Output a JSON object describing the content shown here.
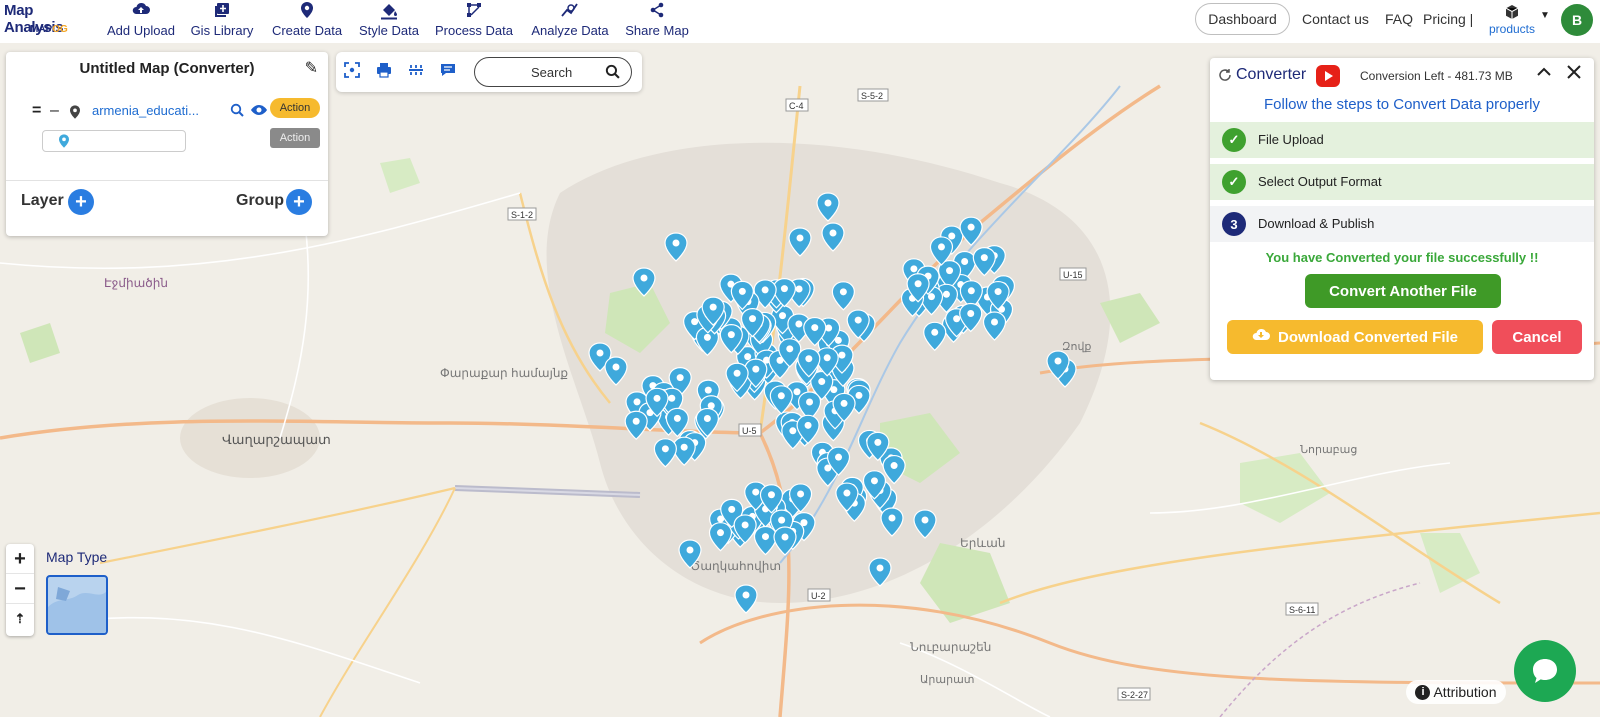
{
  "brand": {
    "title": "Map Analysis",
    "sub_prefix": "MAP",
    "sub_suffix": "OG"
  },
  "nav": [
    {
      "label": "Add Upload",
      "icon": "cloud-upload-icon"
    },
    {
      "label": "Gis Library",
      "icon": "library-icon"
    },
    {
      "label": "Create Data",
      "icon": "map-marker-icon"
    },
    {
      "label": "Style Data",
      "icon": "paint-bucket-icon"
    },
    {
      "label": "Process Data",
      "icon": "process-icon"
    },
    {
      "label": "Analyze Data",
      "icon": "analyze-icon"
    },
    {
      "label": "Share Map",
      "icon": "share-icon"
    }
  ],
  "header_right": {
    "dashboard": "Dashboard",
    "contact": "Contact us",
    "faq": "FAQ",
    "pricing": "Pricing |",
    "products": "products",
    "avatar_letter": "B"
  },
  "layer_panel": {
    "title": "Untitled Map (Converter)",
    "layer_name": "armenia_educati...",
    "action_label": "Action",
    "action_label_2": "Action",
    "layer_label": "Layer",
    "group_label": "Group"
  },
  "toolbar": {
    "search_placeholder": "Search"
  },
  "converter": {
    "title": "Converter",
    "conversion_left": "Conversion Left - 481.73 MB",
    "subtitle": "Follow the steps to Convert Data properly",
    "steps": [
      {
        "label": "File Upload",
        "status": "done"
      },
      {
        "label": "Select Output Format",
        "status": "done"
      },
      {
        "number": "3",
        "label": "Download & Publish",
        "status": "current"
      }
    ],
    "success_message": "You have Converted your file successfully !!",
    "convert_another": "Convert Another File",
    "download": "Download Converted File",
    "cancel": "Cancel"
  },
  "map": {
    "map_type_label": "Map Type",
    "attribution": "Attribution",
    "place_labels": [
      "Վաղարշապատ",
      "Փարաքար համայնք",
      "Էջմիածին",
      "Ծաղկահովիտ",
      "Երևան",
      "Նորաբաց",
      "Զովք",
      "Նուբարաշեն",
      "Արարատ"
    ],
    "road_labels": [
      "U-5",
      "U-2",
      "U-15",
      "S-5-2",
      "S-1-2",
      "C-4",
      "S-6-11",
      "S-2-27"
    ]
  },
  "colors": {
    "brand_blue": "#1e2a78",
    "accent_green": "#3fa12f",
    "accent_orange": "#f6ba2e",
    "accent_red": "#f04e5a",
    "marker_blue": "#3fa9dc"
  }
}
